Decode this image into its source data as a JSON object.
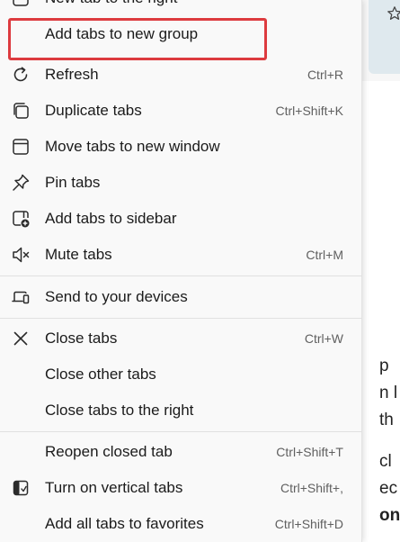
{
  "background": {
    "text_lines": [
      "p",
      "n l",
      "th",
      "cl",
      "ec",
      "on"
    ]
  },
  "menu": {
    "highlight_color": "#dd3b3f",
    "items": [
      {
        "label": "New tab to the right",
        "shortcut": "",
        "icon": "none"
      },
      {
        "label": "Add tabs to new group",
        "shortcut": "",
        "icon": "none"
      },
      {
        "label": "Refresh",
        "shortcut": "Ctrl+R",
        "icon": "refresh-icon"
      },
      {
        "label": "Duplicate tabs",
        "shortcut": "Ctrl+Shift+K",
        "icon": "duplicate-icon"
      },
      {
        "label": "Move tabs to new window",
        "shortcut": "",
        "icon": "window-icon"
      },
      {
        "label": "Pin tabs",
        "shortcut": "",
        "icon": "pin-icon"
      },
      {
        "label": "Add tabs to sidebar",
        "shortcut": "",
        "icon": "sidebar-add-icon"
      },
      {
        "label": "Mute tabs",
        "shortcut": "Ctrl+M",
        "icon": "mute-icon"
      },
      {
        "label": "Send to your devices",
        "shortcut": "",
        "icon": "devices-icon"
      },
      {
        "label": "Close tabs",
        "shortcut": "Ctrl+W",
        "icon": "close-icon"
      },
      {
        "label": "Close other tabs",
        "shortcut": "",
        "icon": "none"
      },
      {
        "label": "Close tabs to the right",
        "shortcut": "",
        "icon": "none"
      },
      {
        "label": "Reopen closed tab",
        "shortcut": "Ctrl+Shift+T",
        "icon": "none"
      },
      {
        "label": "Turn on vertical tabs",
        "shortcut": "Ctrl+Shift+,",
        "icon": "vertical-tabs-icon"
      },
      {
        "label": "Add all tabs to favorites",
        "shortcut": "Ctrl+Shift+D",
        "icon": "none"
      }
    ]
  }
}
